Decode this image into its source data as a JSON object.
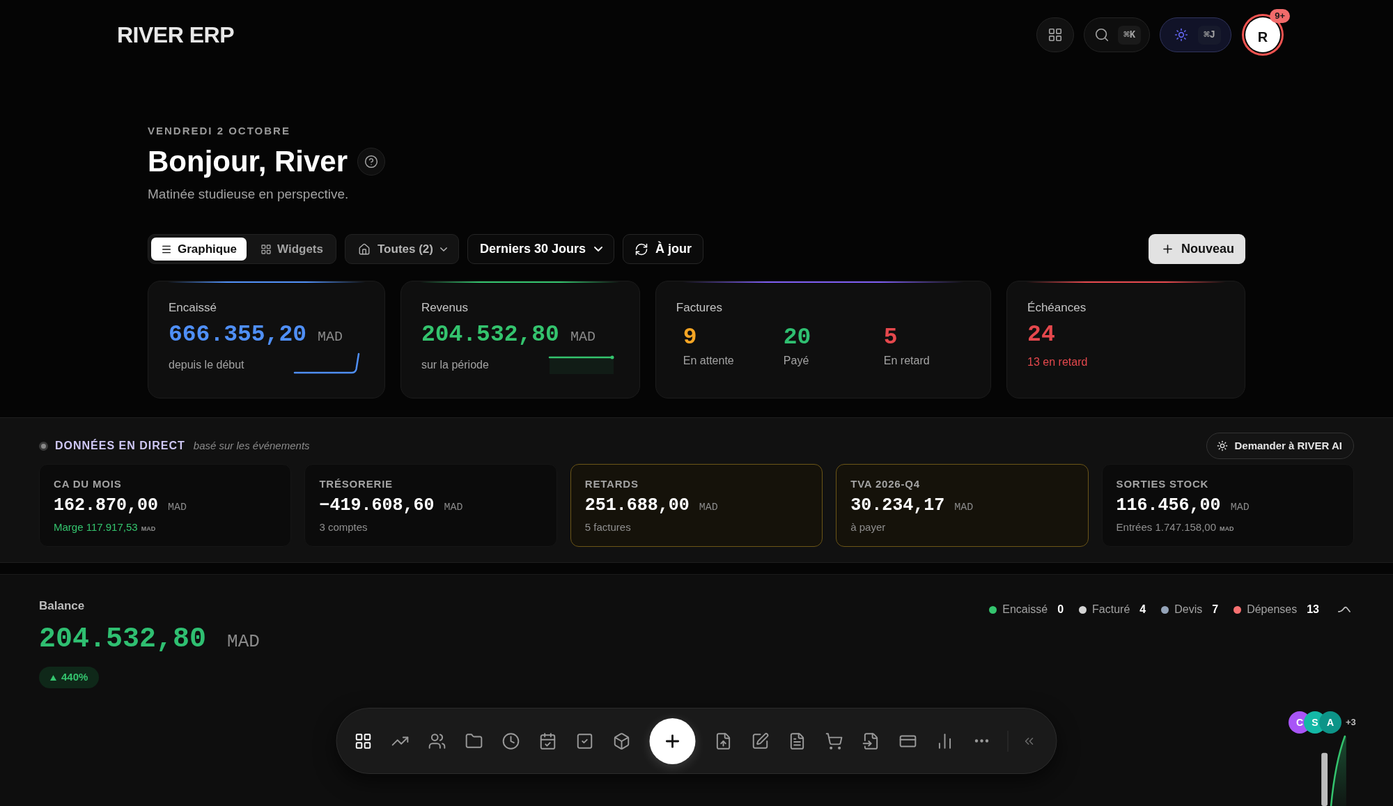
{
  "app": {
    "logo": "RIVER ERP"
  },
  "topbar": {
    "search_shortcut": "⌘K",
    "ai_shortcut": "⌘J",
    "avatar_initial": "R",
    "notification_badge": "9+"
  },
  "header": {
    "date": "VENDREDI 2 OCTOBRE",
    "greeting": "Bonjour, River",
    "subtitle": "Matinée studieuse en perspective."
  },
  "toolbar": {
    "view_tabs": [
      {
        "label": "Graphique",
        "selected": true
      },
      {
        "label": "Widgets",
        "selected": false
      }
    ],
    "scope_filter": "Toutes (2)",
    "period_filter": "Derniers 30 Jours",
    "sync_button": "À jour",
    "new_button": "Nouveau"
  },
  "kpi_cards": [
    {
      "kind": "amount",
      "title": "Encaissé",
      "value": "666.355,20",
      "unit": "MAD",
      "caption": "depuis le début",
      "color": "#4f8ff6"
    },
    {
      "kind": "amount",
      "title": "Revenus",
      "value": "204.532,80",
      "unit": "MAD",
      "caption": "sur la période",
      "color": "#34c46e"
    },
    {
      "kind": "counts",
      "title": "Factures",
      "color": "#7c5cf0",
      "counts": [
        {
          "value": "9",
          "label": "En attente",
          "color": "#f5a524"
        },
        {
          "value": "20",
          "label": "Payé",
          "color": "#2fbf71"
        },
        {
          "value": "5",
          "label": "En retard",
          "color": "#e5484d"
        }
      ]
    },
    {
      "kind": "total",
      "title": "Échéances",
      "value": "24",
      "caption": "13 en retard",
      "color": "#e5484d"
    }
  ],
  "live": {
    "title": "DONNÉES EN DIRECT",
    "subtitle": "basé sur les événements",
    "ai_button": "Demander à RIVER AI",
    "cards": [
      {
        "label": "CA DU MOIS",
        "value": "162.870,00",
        "unit": "MAD",
        "note": "Marge 117.917,53",
        "note_unit": "MAD",
        "note_positive": true,
        "highlighted": false
      },
      {
        "label": "TRÉSORERIE",
        "value": "−419.608,60",
        "unit": "MAD",
        "note": "3 comptes",
        "note_positive": false,
        "highlighted": false
      },
      {
        "label": "RETARDS",
        "value": "251.688,00",
        "unit": "MAD",
        "note": "5 factures",
        "note_positive": false,
        "highlighted": true
      },
      {
        "label": "TVA 2026-Q4",
        "value": "30.234,17",
        "unit": "MAD",
        "note": "à payer",
        "note_positive": false,
        "highlighted": true
      },
      {
        "label": "SORTIES STOCK",
        "value": "116.456,00",
        "unit": "MAD",
        "note": "Entrées 1.747.158,00",
        "note_unit": "MAD",
        "note_positive": false,
        "highlighted": false
      }
    ]
  },
  "balance": {
    "title": "Balance",
    "value": "204.532,80",
    "unit": "MAD",
    "change": "440%",
    "legend": [
      {
        "label": "Encaissé",
        "count": "0",
        "color": "#34c46e"
      },
      {
        "label": "Facturé",
        "count": "4",
        "color": "#d4d4d4"
      },
      {
        "label": "Devis",
        "count": "7",
        "color": "#94a3b8"
      },
      {
        "label": "Dépenses",
        "count": "13",
        "color": "#f87171"
      }
    ]
  },
  "dock": {
    "left_items": [
      {
        "selected": true
      },
      {
        "selected": false
      },
      {
        "selected": false
      },
      {
        "selected": false
      },
      {
        "selected": false
      },
      {
        "selected": false
      },
      {
        "selected": false
      },
      {
        "selected": false
      }
    ],
    "right_items": [
      {
        "selected": false
      },
      {
        "selected": false
      },
      {
        "selected": false
      },
      {
        "selected": false
      },
      {
        "selected": false
      },
      {
        "selected": false
      },
      {
        "selected": false
      },
      {
        "selected": false
      }
    ]
  },
  "presence": {
    "avatars": [
      {
        "initial": "C",
        "color": "#a855f7"
      },
      {
        "initial": "S",
        "color": "#14b8a6"
      },
      {
        "initial": "A",
        "color": "#0d9488"
      }
    ],
    "more": "+3"
  }
}
